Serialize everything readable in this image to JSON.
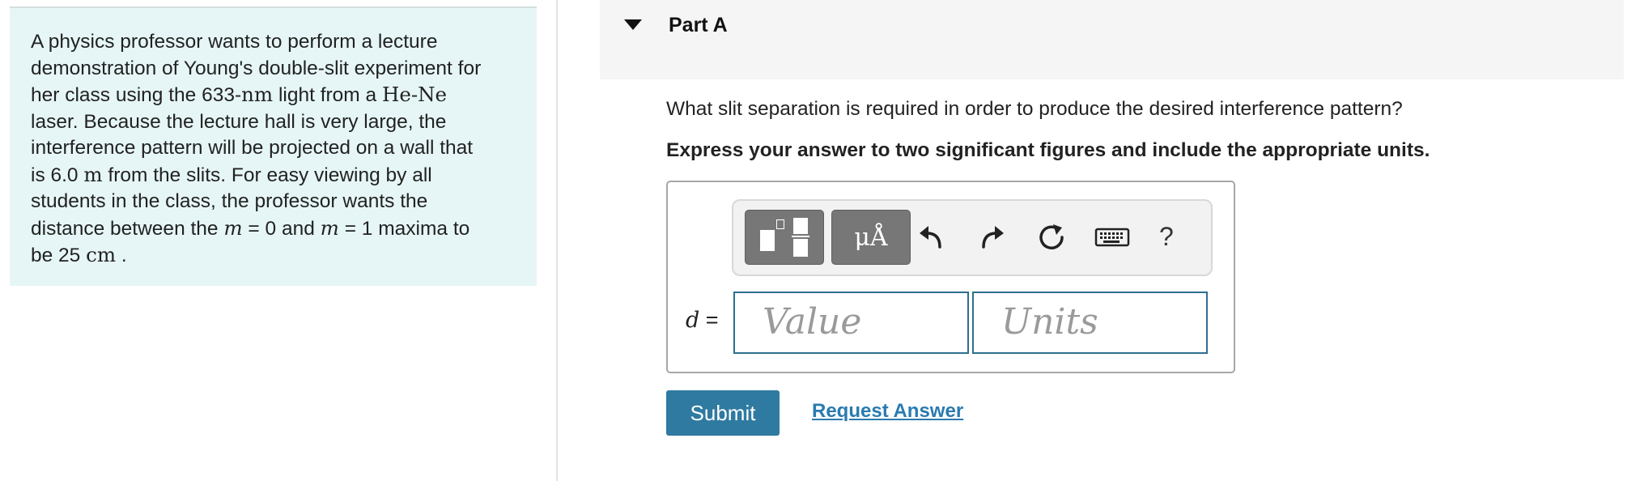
{
  "problem": {
    "p1": "A physics professor wants to perform a lecture",
    "p2": "demonstration of Young's double-slit experiment for",
    "p3a": "her class using the 633-",
    "p3_nm": "nm",
    "p3b": " light from a ",
    "p3_laser": "He-Ne",
    "p4": "laser. Because the lecture hall is very large, the",
    "p5": "interference pattern will be projected on a wall that",
    "p6a": "is 6.0 ",
    "p6_m": "m",
    "p6b": " from the slits. For easy viewing by all",
    "p7": "students in the class, the professor wants the",
    "p8a": "distance between the ",
    "m_var": "m",
    "p8b": " = 0 and ",
    "p8c": " = 1 maxima to",
    "p9a": "be 25 ",
    "p9_cm": "cm",
    "p9b": " ."
  },
  "part": {
    "title": "Part A",
    "question": "What slit separation is required in order to produce the desired interference pattern?",
    "instruction": "Express your answer to two significant figures and include the appropriate units."
  },
  "toolbar": {
    "units_label": "μÅ",
    "help_label": "?",
    "icons": [
      "templates-icon",
      "units-icon",
      "undo-icon",
      "redo-icon",
      "reset-icon",
      "keyboard-icon",
      "help-icon"
    ]
  },
  "answer": {
    "variable": "d",
    "equals": " =",
    "value_placeholder": "Value",
    "units_placeholder": "Units"
  },
  "actions": {
    "submit_label": "Submit",
    "request_label": "Request Answer"
  },
  "colors": {
    "panel_bg": "#e6f6f6",
    "accent": "#2f7aa0",
    "link": "#2a7bb0"
  }
}
